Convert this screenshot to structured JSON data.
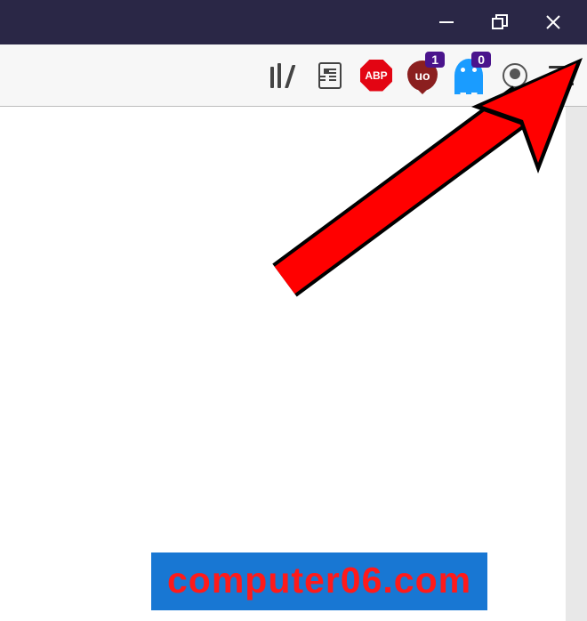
{
  "window_controls": {
    "minimize": "minimize",
    "maximize": "restore",
    "close": "close"
  },
  "toolbar": {
    "library_label": "Library",
    "reader_label": "Reader View",
    "adblock_label": "ABP",
    "ublock_label": "uo",
    "ublock_badge": "1",
    "ghostery_label": "Ghostery",
    "ghostery_badge": "0",
    "profile_label": "Account",
    "menu_label": "Menu"
  },
  "watermark_text": "computer06.com"
}
